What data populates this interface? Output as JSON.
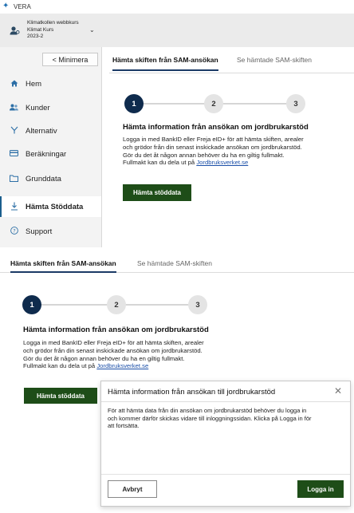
{
  "app": {
    "title": "VERA"
  },
  "account": {
    "line1": "Klimatkollen webbkurs",
    "line2": "Klimat Kurs",
    "line3": "2023-2"
  },
  "sidebar": {
    "minimize_label": "< Minimera",
    "items": [
      {
        "label": "Hem",
        "icon": "home-icon"
      },
      {
        "label": "Kunder",
        "icon": "users-icon"
      },
      {
        "label": "Alternativ",
        "icon": "branch-icon"
      },
      {
        "label": "Beräkningar",
        "icon": "card-icon"
      },
      {
        "label": "Grunddata",
        "icon": "folder-icon"
      },
      {
        "label": "Hämta Stöddata",
        "icon": "download-icon",
        "active": true
      },
      {
        "label": "Support",
        "icon": "help-icon"
      }
    ]
  },
  "tabs": [
    {
      "label": "Hämta skiften från SAM-ansökan",
      "active": true
    },
    {
      "label": "Se hämtade SAM-skiften",
      "active": false
    }
  ],
  "steps": [
    "1",
    "2",
    "3"
  ],
  "content": {
    "heading": "Hämta information från ansökan om jordbrukarstöd",
    "line1": "Logga in med BankID eller Freja eID+ för att hämta skiften, arealer",
    "line2": "och grödor från din senast inskickade ansökan om jordbrukarstöd.",
    "line3": "Gör du det åt någon annan behöver du ha en giltig fullmakt.",
    "line4": "Fullmakt kan du dela ut på ",
    "link": "Jordbruksverket.se",
    "button": "Hämta stöddata"
  },
  "modal": {
    "title": "Hämta information från ansökan till jordbrukarstöd",
    "body_line1": "För att hämta data från din ansökan om jordbrukarstöd behöver du logga in",
    "body_line2": "och kommer därför skickas vidare till inloggningssidan. Klicka på Logga in för",
    "body_line3": "att fortsätta.",
    "cancel": "Avbryt",
    "confirm": "Logga in"
  },
  "colors": {
    "primary_green": "#1e4d18",
    "step_active": "#0f2b4d",
    "link": "#1b4fa8"
  }
}
